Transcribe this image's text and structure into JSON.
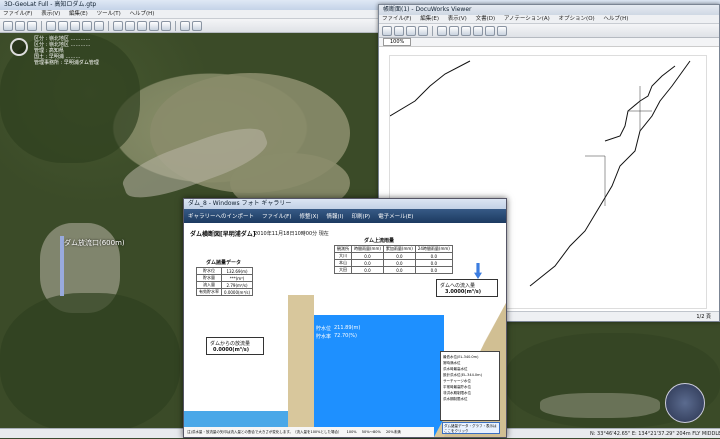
{
  "main_window": {
    "title": "3D-GeoLat Full - 高知ロダム.gtp",
    "menu": [
      "ファイル(F)",
      "表示(V)",
      "編集(E)",
      "ツール(T)",
      "ヘルプ(H)"
    ]
  },
  "map": {
    "label": "ダム放流口(600m)",
    "overlay_lines": [
      "区分 : 嶺北地区 …………",
      "区分 : 嶺北地区 …………",
      "管理 : 高知県",
      "国土 : 早明浦 ………",
      "管理事務所 : 早明浦ダム管理"
    ]
  },
  "status": {
    "coords": "N: 33°46'42.65\"  E: 134°21'37.29\"  204m   FLY  MIDDLE",
    "scale": ""
  },
  "docuworks": {
    "title": "帳断面(1) - DocuWorks Viewer",
    "menu": [
      "ファイル(F)",
      "編集(E)",
      "表示(V)",
      "文書(D)",
      "アノテーション(A)",
      "オプション(O)",
      "ヘルプ(H)"
    ],
    "zoom": "100%",
    "page": "1/2",
    "page_label": "1/2  頁"
  },
  "gallery": {
    "title": "ダム_8 - Windows フォト ギャラリー",
    "toolbar": [
      "ギャラリーへのインポート",
      "ファイル(F)",
      "修整(X)",
      "情報(I)",
      "印刷(P)",
      "電子メール(E)"
    ],
    "doc_title": "ダム横断図[早明浦ダム]",
    "date": "2010年11月18日10時00分  現在",
    "inflow_header": "ダム上流雨量",
    "storage_header": "ダム諸量データ",
    "storage_rows": [
      [
        "貯水位",
        "132.69(m)"
      ],
      [
        "貯水量",
        "***(m³)"
      ],
      [
        "流入量",
        "2.79(m³/s)"
      ],
      [
        "有効貯水率",
        "0.0000(m³/s)"
      ]
    ],
    "rain_cols": [
      "観測所",
      "時間雨量(mm)",
      "累加雨量(mm)",
      "24時間雨量(mm)"
    ],
    "rain_rows": [
      [
        "大川",
        "0.0",
        "0.0",
        "0.0"
      ],
      [
        "本山",
        "0.0",
        "0.0",
        "0.0"
      ],
      [
        "大田",
        "0.0",
        "0.0",
        "0.0"
      ]
    ],
    "inflow_label": "ダムへの流入量",
    "inflow_value": "3.0000(m³/s)",
    "outflow_label": "ダムからの放流量",
    "outflow_value": "0.0000(m³/s)",
    "water_level_label": "貯水位",
    "water_level_value": "211.89(m)",
    "storage_label": "貯水率",
    "storage_value": "72.70(%)",
    "right_notes": [
      "最低水位(EL.340.0m)",
      "常時満水位",
      "洪水時最高水位",
      "設計洪水位(EL.344.0m)",
      "サーチャージ水位",
      "平常時最高貯水位",
      "非洪水期制限水位",
      "洪水期制限水位"
    ],
    "bottom_note": "注)洪水量・放流量の矢印は流入量との割合で大きさが変化します。（流入量を100%とした場合）",
    "legend_100": "100%",
    "legend_50": "50%〜80%",
    "legend_small": "20%未満",
    "click_note": "ダム諸量データ・グラフ・表示はここをクリック"
  }
}
